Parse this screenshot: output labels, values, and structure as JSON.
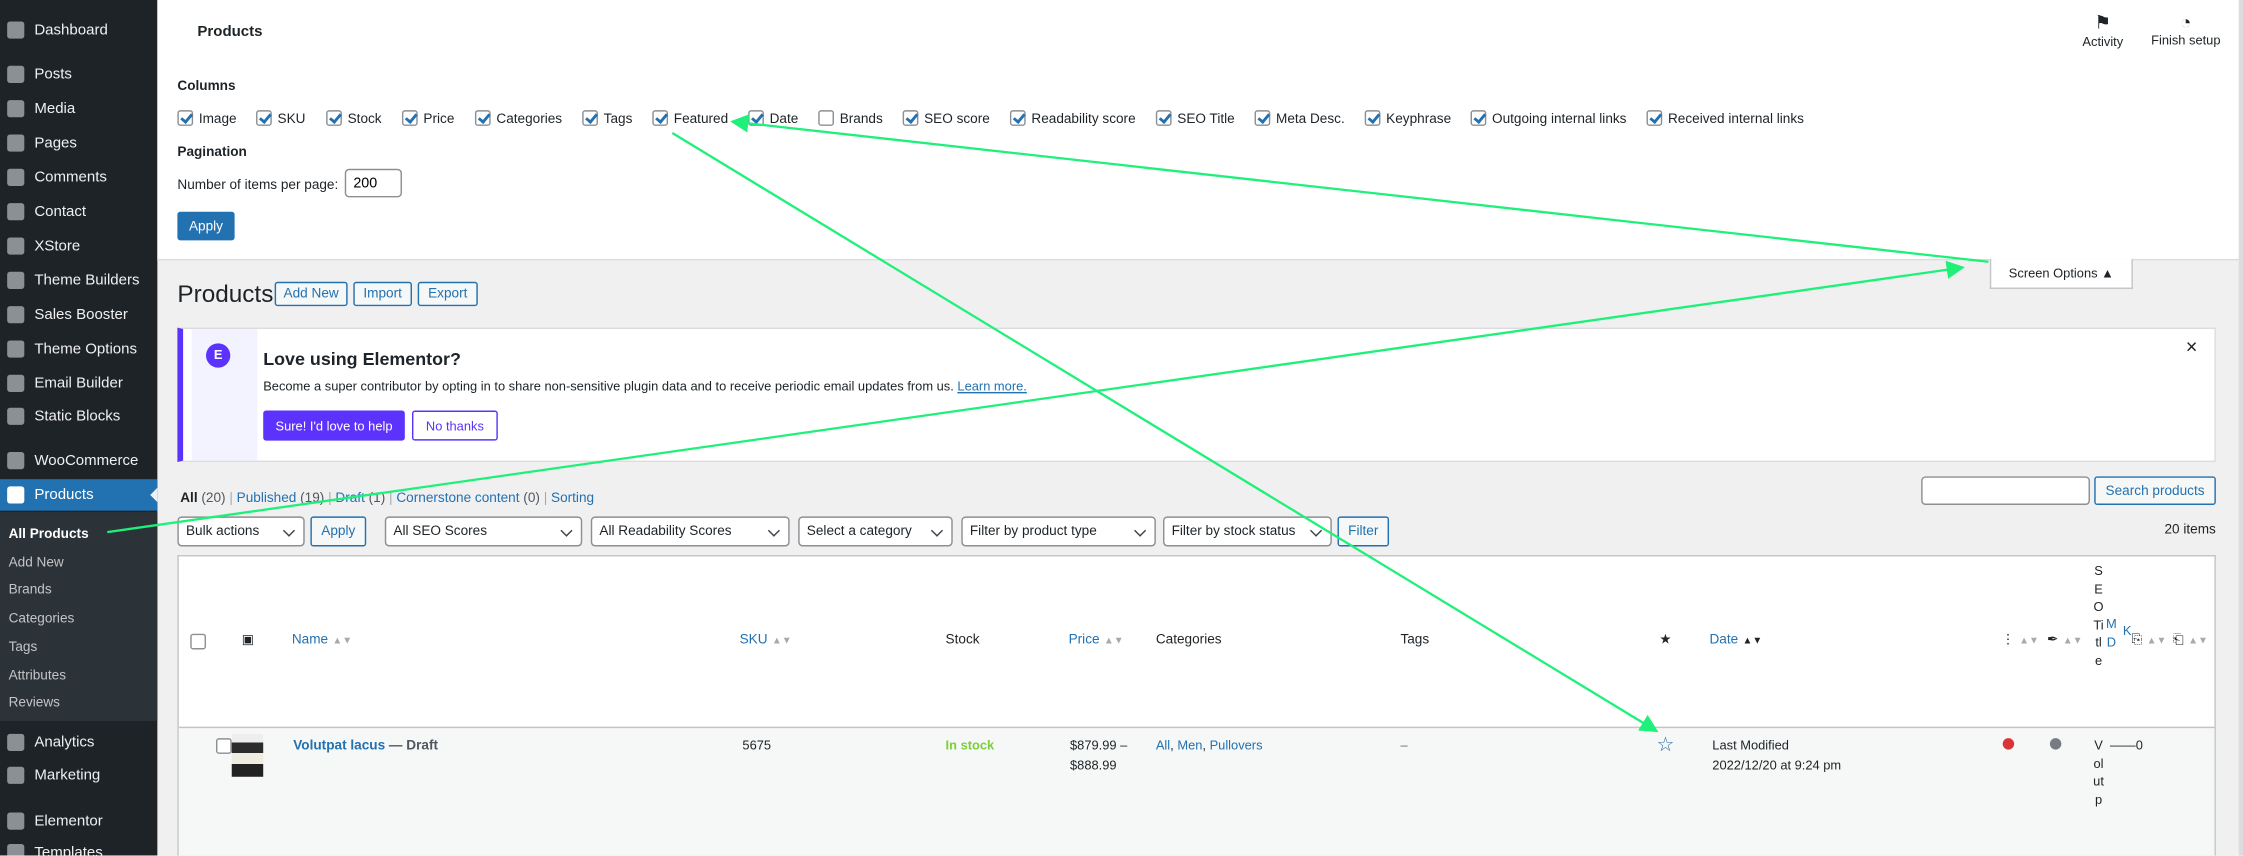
{
  "sidebar": {
    "items": [
      {
        "label": "Dashboard",
        "icon": "dashboard-icon"
      },
      {
        "label": "Posts",
        "icon": "pin-icon"
      },
      {
        "label": "Media",
        "icon": "media-icon"
      },
      {
        "label": "Pages",
        "icon": "pages-icon"
      },
      {
        "label": "Comments",
        "icon": "comment-icon"
      },
      {
        "label": "Contact",
        "icon": "mail-icon"
      },
      {
        "label": "XStore",
        "icon": "xstore-icon"
      },
      {
        "label": "Theme Builders",
        "icon": "xstore-icon"
      },
      {
        "label": "Sales Booster",
        "icon": "chart-icon"
      },
      {
        "label": "Theme Options",
        "icon": "options-icon"
      },
      {
        "label": "Email Builder",
        "icon": "mail-icon"
      },
      {
        "label": "Static Blocks",
        "icon": "blocks-icon"
      },
      {
        "label": "WooCommerce",
        "icon": "woo-icon"
      },
      {
        "label": "Products",
        "icon": "archive-icon",
        "active": true
      },
      {
        "label": "Analytics",
        "icon": "chart-icon"
      },
      {
        "label": "Marketing",
        "icon": "megaphone-icon"
      },
      {
        "label": "Elementor",
        "icon": "elementor-icon"
      },
      {
        "label": "Templates",
        "icon": "folder-icon"
      }
    ],
    "submenu": [
      "All Products",
      "Add New",
      "Brands",
      "Categories",
      "Tags",
      "Attributes",
      "Reviews"
    ]
  },
  "header": {
    "title": "Products",
    "activity": "Activity",
    "finish_setup": "Finish setup"
  },
  "screen_options": {
    "columns_label": "Columns",
    "columns": [
      {
        "label": "Image",
        "checked": true
      },
      {
        "label": "SKU",
        "checked": true
      },
      {
        "label": "Stock",
        "checked": true
      },
      {
        "label": "Price",
        "checked": true
      },
      {
        "label": "Categories",
        "checked": true
      },
      {
        "label": "Tags",
        "checked": true
      },
      {
        "label": "Featured",
        "checked": true
      },
      {
        "label": "Date",
        "checked": true
      },
      {
        "label": "Brands",
        "checked": false
      },
      {
        "label": "SEO score",
        "checked": true
      },
      {
        "label": "Readability score",
        "checked": true
      },
      {
        "label": "SEO Title",
        "checked": true
      },
      {
        "label": "Meta Desc.",
        "checked": true
      },
      {
        "label": "Keyphrase",
        "checked": true
      },
      {
        "label": "Outgoing internal links",
        "checked": true
      },
      {
        "label": "Received internal links",
        "checked": true
      }
    ],
    "pagination_label": "Pagination",
    "items_per_page_label": "Number of items per page:",
    "items_per_page": "200",
    "apply": "Apply",
    "tab_label": "Screen Options ▲"
  },
  "page": {
    "title": "Products",
    "add_new": "Add New",
    "import": "Import",
    "export": "Export"
  },
  "notice": {
    "title": "Love using Elementor?",
    "text": "Become a super contributor by opting in to share non-sensitive plugin data and to receive periodic email updates from us.",
    "learn_more": "Learn more.",
    "yes": "Sure! I'd love to help",
    "no": "No thanks",
    "close": "×",
    "accent": "#5c33fc"
  },
  "views": [
    {
      "label": "All",
      "count": "(20)",
      "current": true
    },
    {
      "label": "Published",
      "count": "(19)"
    },
    {
      "label": "Draft",
      "count": "(1)"
    },
    {
      "label": "Cornerstone content",
      "count": "(0)"
    },
    {
      "label": "Sorting",
      "count": ""
    }
  ],
  "search": {
    "value": "",
    "button": "Search products"
  },
  "filters": {
    "bulk": "Bulk actions",
    "apply": "Apply",
    "seo": "All SEO Scores",
    "readability": "All Readability Scores",
    "category": "Select a category",
    "type": "Filter by product type",
    "stock": "Filter by stock status",
    "filter": "Filter",
    "count": "20 items"
  },
  "table": {
    "headers": {
      "name": "Name",
      "sku": "SKU",
      "stock": "Stock",
      "price": "Price",
      "categories": "Categories",
      "tags": "Tags",
      "date": "Date",
      "seo_title": "SEOTitle",
      "meta": "MD",
      "keyphrase": "K"
    },
    "rows": [
      {
        "name": "Volutpat lacus",
        "state": "— Draft",
        "sku": "5675",
        "stock": "In stock",
        "price_1": "$879.99 –",
        "price_2": "$888.99",
        "categories": [
          "All",
          "Men",
          "Pullovers"
        ],
        "tags": "–",
        "featured": false,
        "date_1": "Last Modified",
        "date_2": "2022/12/20 at 9:24 pm",
        "seo_score": "#d63638",
        "readability": "#787c82",
        "seo_title": "Volutp",
        "meta_kw": "——0"
      }
    ]
  },
  "colors": {
    "admin_blue": "#2271b1",
    "sidebar": "#1d2327",
    "in_stock": "#7ad03a",
    "annotation": "#1ef07a"
  }
}
